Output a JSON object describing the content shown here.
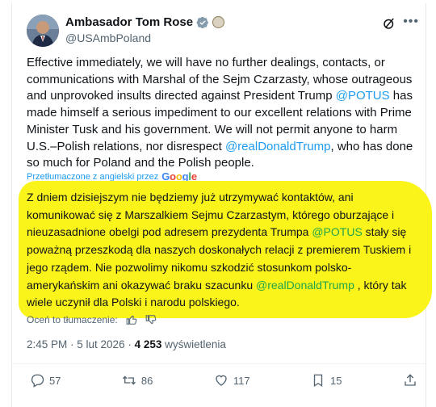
{
  "author": {
    "name": "Ambasador Tom Rose",
    "handle": "@USAmbPoland"
  },
  "icons": {
    "verified": "verified-badge-icon",
    "seal": "us-embassy-seal-icon",
    "grok": "grok-icon",
    "more": "more-options-icon"
  },
  "tweet": {
    "p1": "Effective immediately, we will have no further dealings, contacts, or communications with Marshal of the Sejm Czarzasty, whose outrageous and unprovoked insults directed  against President Trump ",
    "m1": "@POTUS",
    "p2": " has made himself a serious impediment to our excellent relations with Prime Minister Tusk and his government. We will not permit anyone to harm U.S.–Polish relations, nor disrespect ",
    "m2": "@realDonaldTrump",
    "p3": ", who has done so much for Poland and the Polish people."
  },
  "translation": {
    "label": "Przetłumaczone z angielski przez",
    "provider": "Google",
    "p1": "Z dniem dzisiejszym nie będziemy już utrzymywać kontaktów, ani komunikować się z Marszalkiem Sejmu Czarzastym, którego oburzające i nieuzasadnione obelgi pod adresem prezydenta Trumpa ",
    "m1": "@POTUS",
    "p2": " stały się poważną przeszkodą dla naszych doskonałych relacji z premierem Tuskiem i jego rządem. Nie pozwolimy nikomu szkodzić stosunkom polsko-amerykańskim ani okazywać braku szacunku ",
    "m2": "@realDonaldTrump",
    "p3": " , który tak wiele uczynił dla Polski i narodu polskiego.",
    "rate_label": "Oceń to tłumaczenie:"
  },
  "meta": {
    "time": "2:45 PM · 5 lut 2026 · ",
    "views_count": "4 253",
    "views_label": " wyświetlenia"
  },
  "actions": {
    "replies": "57",
    "reposts": "86",
    "likes": "117",
    "bookmarks": "15"
  },
  "colors": {
    "highlight": "#fbf41a",
    "link_blue": "#1d9bf0",
    "link_green": "#21a54a"
  }
}
